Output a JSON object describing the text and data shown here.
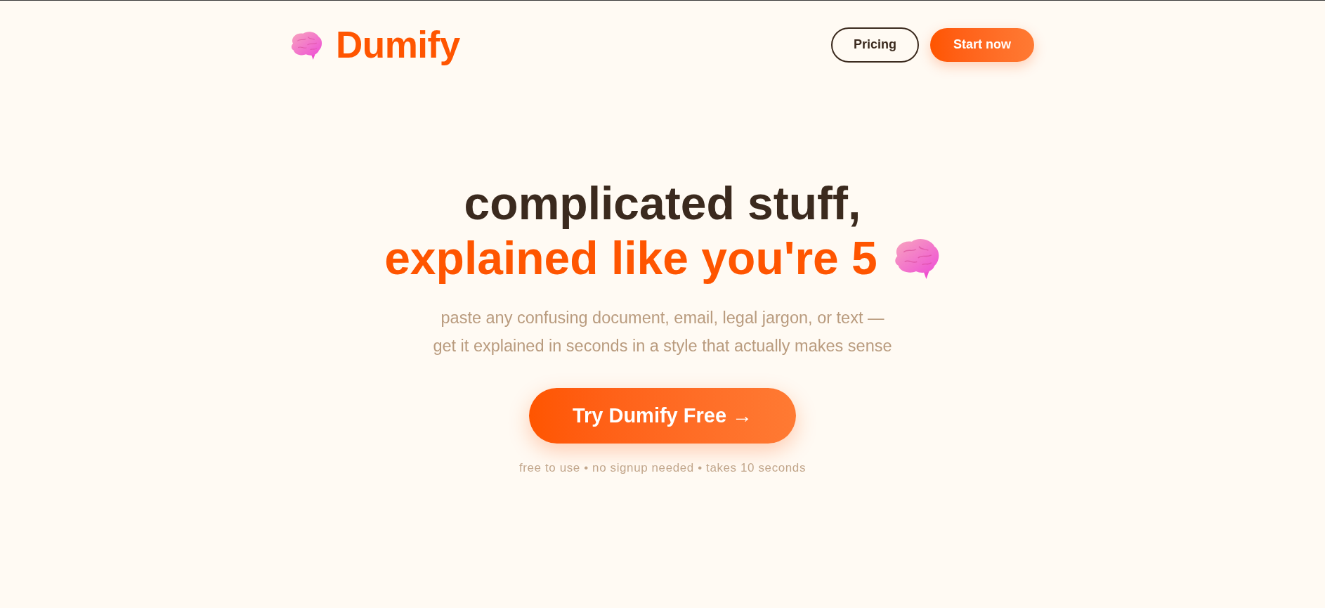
{
  "header": {
    "logo": {
      "text": "Dumify"
    },
    "nav": [
      {
        "label": "Pricing",
        "kind": "outline"
      },
      {
        "label": "Start now",
        "kind": "primary"
      }
    ]
  },
  "hero": {
    "headline": {
      "line_1": "complicated stuff,",
      "line_2": "explained like you're 5"
    },
    "subtitle": "paste any confusing document, email, legal jargon, or text —\nget it explained in seconds in a style that actually makes sense",
    "cta": {
      "label": "Try Dumify Free →"
    },
    "note": "free to use • no signup needed • takes 10 seconds"
  }
}
